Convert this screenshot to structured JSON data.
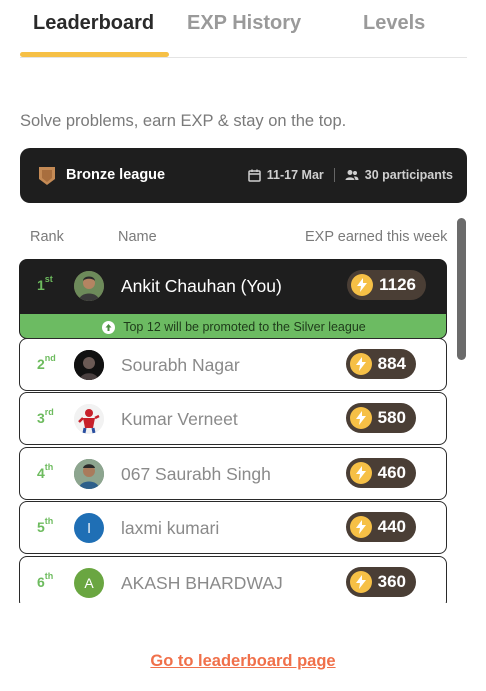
{
  "tabs": [
    {
      "label": "Leaderboard",
      "active": true
    },
    {
      "label": "EXP History",
      "active": false
    },
    {
      "label": "Levels",
      "active": false
    }
  ],
  "subtitle": "Solve problems, earn EXP & stay on the top.",
  "league": {
    "name": "Bronze league",
    "dates": "11-17 Mar",
    "participants": "30 participants",
    "badge_color": "#c48a55"
  },
  "columns": {
    "rank": "Rank",
    "name": "Name",
    "exp": "EXP earned this week"
  },
  "promotion_note": "Top 12 will be promoted to the Silver league",
  "rows": [
    {
      "rank": "1",
      "suffix": "st",
      "name": "Ankit Chauhan (You)",
      "exp": "1126",
      "avatar": "photo",
      "is_you": true
    },
    {
      "rank": "2",
      "suffix": "nd",
      "name": "Sourabh Nagar",
      "exp": "884",
      "avatar": "photo"
    },
    {
      "rank": "3",
      "suffix": "rd",
      "name": "Kumar Verneet",
      "exp": "580",
      "avatar": "photo"
    },
    {
      "rank": "4",
      "suffix": "th",
      "name": "067 Saurabh Singh",
      "exp": "460",
      "avatar": "photo"
    },
    {
      "rank": "5",
      "suffix": "th",
      "name": "laxmi kumari",
      "exp": "440",
      "avatar": "letter",
      "initial": "l",
      "avatar_color": "#1f6fb5"
    },
    {
      "rank": "6",
      "suffix": "th",
      "name": "AKASH BHARDWAJ",
      "exp": "360",
      "avatar": "letter",
      "initial": "A",
      "avatar_color": "#6aa641"
    }
  ],
  "footer_link": "Go to leaderboard page",
  "colors": {
    "accent": "#f6c046",
    "rank_green": "#6dbb5e",
    "promo_green": "#6cbb62",
    "link_orange": "#f0704a",
    "pill_brown": "#4a3e35"
  }
}
